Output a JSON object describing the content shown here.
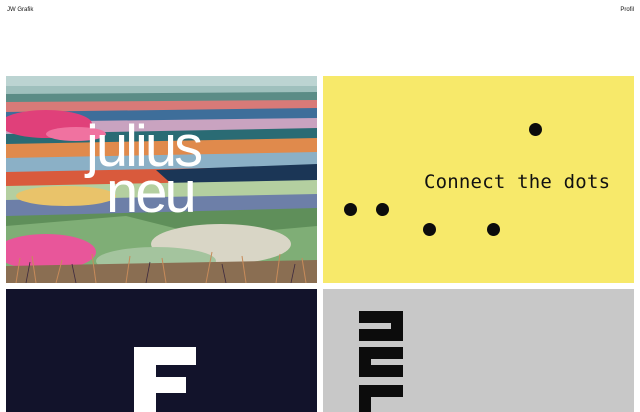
{
  "header": {
    "brand": "JW Grafik",
    "profile_link": "Profil"
  },
  "tiles": [
    {
      "id": "julius-neu",
      "lines": [
        "julius",
        "neu"
      ],
      "colors": {
        "text": "#ffffff"
      }
    },
    {
      "id": "connect-the-dots",
      "label": "Connect the dots",
      "colors": {
        "background": "#f7e96a",
        "dots": "#0c0c0c"
      }
    },
    {
      "id": "navy-letterform",
      "colors": {
        "background": "#12132b",
        "shape": "#ffffff"
      }
    },
    {
      "id": "grey-letterform",
      "colors": {
        "background": "#c8c8c8",
        "shape": "#0c0c0c"
      }
    }
  ]
}
